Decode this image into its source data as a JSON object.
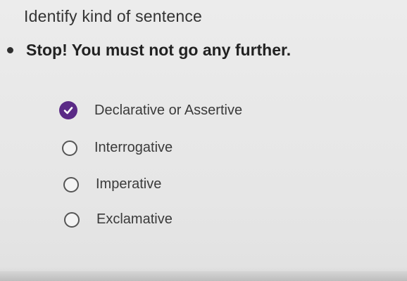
{
  "header": {
    "title": "Identify kind of sentence"
  },
  "question": {
    "text": "Stop! You must not go any further."
  },
  "options": [
    {
      "label": "Declarative or Assertive",
      "selected": true
    },
    {
      "label": "Interrogative",
      "selected": false
    },
    {
      "label": "Imperative",
      "selected": false
    },
    {
      "label": "Exclamative",
      "selected": false
    }
  ],
  "colors": {
    "accent": "#5a2a86",
    "background": "#e9e9e9",
    "text": "#333333"
  },
  "icons": {
    "bullet": "bullet-dot-icon",
    "selected_radio": "radio-checked-icon",
    "unselected_radio": "radio-unchecked-icon"
  }
}
